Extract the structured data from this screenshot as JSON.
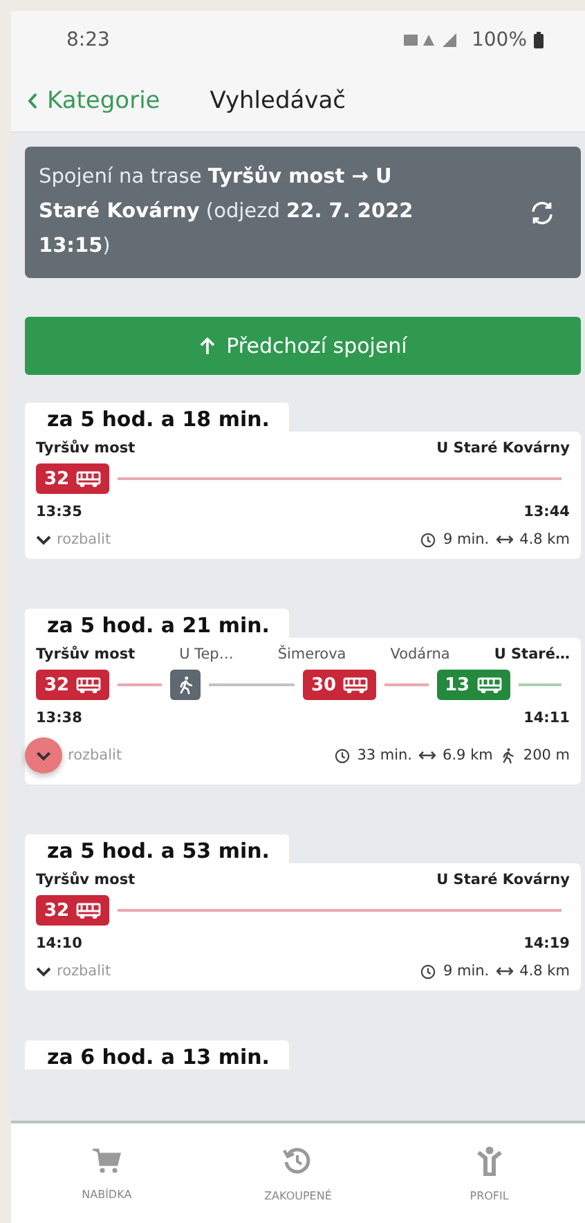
{
  "status_bar": {
    "time": "8:23",
    "battery": "100%"
  },
  "header": {
    "back_label": "Kategorie",
    "title": "Vyhledávač"
  },
  "route_banner": {
    "text": "Spojení na trase **Tyršův most → U Staré Kovárny** (odjezd **22. 7. 2022 13:15**)"
  },
  "previous_button": {
    "label": "Předchozí spojení"
  },
  "connections": [
    {
      "departs_in": "za 5 hod. a 18 min.",
      "stops": [
        {
          "name": "Tyršův most",
          "kind": "endpoint"
        },
        {
          "name": "U Staré Kovárny",
          "kind": "endpoint"
        }
      ],
      "legs": [
        {
          "kind": "bus",
          "line": "32",
          "color": "#c9283a"
        }
      ],
      "dep_time": "13:35",
      "arr_time": "13:44",
      "expand_label": "rozbalit",
      "expand_pressed": false,
      "duration": "9 min.",
      "distance": "4.8 km"
    },
    {
      "departs_in": "za 5 hod. a 21 min.",
      "stops": [
        {
          "name": "Tyršův most",
          "kind": "endpoint"
        },
        {
          "name": "U Tep…",
          "kind": "transfer"
        },
        {
          "name": "Šimerova",
          "kind": "transfer"
        },
        {
          "name": "Vodárna",
          "kind": "transfer"
        },
        {
          "name": "U Staré…",
          "kind": "endpoint"
        }
      ],
      "legs": [
        {
          "kind": "bus",
          "line": "32",
          "color": "#c9283a"
        },
        {
          "kind": "walk",
          "color": "#5f6770"
        },
        {
          "kind": "bus",
          "line": "30",
          "color": "#c9283a"
        },
        {
          "kind": "bus",
          "line": "13",
          "color": "#23893c"
        }
      ],
      "dep_time": "13:38",
      "arr_time": "14:11",
      "expand_label": "rozbalit",
      "expand_pressed": true,
      "duration": "33 min.",
      "distance": "6.9 km",
      "walk": "200 m"
    },
    {
      "departs_in": "za 5 hod. a 53 min.",
      "stops": [
        {
          "name": "Tyršův most",
          "kind": "endpoint"
        },
        {
          "name": "U Staré Kovárny",
          "kind": "endpoint"
        }
      ],
      "legs": [
        {
          "kind": "bus",
          "line": "32",
          "color": "#c9283a"
        }
      ],
      "dep_time": "14:10",
      "arr_time": "14:19",
      "expand_label": "rozbalit",
      "expand_pressed": false,
      "duration": "9 min.",
      "distance": "4.8 km"
    },
    {
      "departs_in": "za 6 hod. a 13 min."
    }
  ],
  "bottom_nav": [
    {
      "label": "NABÍDKA",
      "kind": "cart"
    },
    {
      "label": "ZAKOUPENÉ",
      "kind": "history"
    },
    {
      "label": "PROFIL",
      "kind": "profile"
    }
  ]
}
